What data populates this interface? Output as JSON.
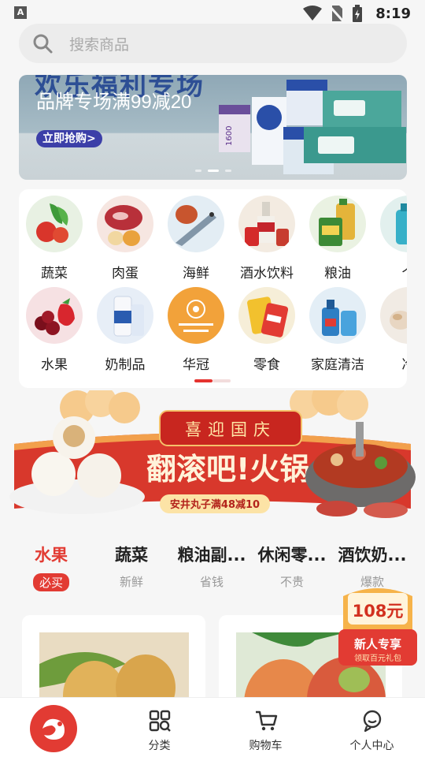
{
  "status_bar": {
    "app_badge": "A",
    "time": "8:19"
  },
  "search": {
    "placeholder": "搜索商品"
  },
  "banner": {
    "headline": "品牌专场满99减20",
    "cta": "立即抢购>",
    "faded_top": "欢乐福利专场",
    "product_badge": "1600"
  },
  "categories": [
    {
      "label": "蔬菜",
      "icon": "vegetables-icon",
      "color": "#e8f1e3"
    },
    {
      "label": "肉蛋",
      "icon": "meat-egg-icon",
      "color": "#f6e6e1"
    },
    {
      "label": "海鲜",
      "icon": "seafood-icon",
      "color": "#e3edf4"
    },
    {
      "label": "酒水饮料",
      "icon": "drinks-icon",
      "color": "#f3ebe1"
    },
    {
      "label": "粮油",
      "icon": "grain-oil-icon",
      "color": "#eaf2e2"
    },
    {
      "label": "个",
      "icon": "personal-care-icon",
      "color": "#e2f0ee"
    },
    {
      "label": "水果",
      "icon": "fruit-icon",
      "color": "#f6e1e3"
    },
    {
      "label": "奶制品",
      "icon": "dairy-icon",
      "color": "#e7eef7"
    },
    {
      "label": "华冠",
      "icon": "huaguan-logo-icon",
      "color": "#f2a23a"
    },
    {
      "label": "零食",
      "icon": "snacks-icon",
      "color": "#f6eed8"
    },
    {
      "label": "家庭清洁",
      "icon": "cleaning-icon",
      "color": "#e3eef6"
    },
    {
      "label": "冷",
      "icon": "frozen-icon",
      "color": "#f1ebe4"
    }
  ],
  "promo": {
    "header": "喜迎国庆",
    "title": "翻滚吧!火锅",
    "subtitle": "安井丸子满48减10"
  },
  "tabs": [
    {
      "title": "水果",
      "subtitle": "必买",
      "active": true
    },
    {
      "title": "蔬菜",
      "subtitle": "新鲜",
      "active": false
    },
    {
      "title": "粮油副...",
      "subtitle": "省钱",
      "active": false
    },
    {
      "title": "休闲零...",
      "subtitle": "不贵",
      "active": false
    },
    {
      "title": "酒饮奶...",
      "subtitle": "爆款",
      "active": false
    }
  ],
  "gift": {
    "amount": "108元",
    "title": "新人专享",
    "subtitle": "领取百元礼包"
  },
  "bottom_nav": [
    {
      "label": "",
      "icon": "home-logo-icon"
    },
    {
      "label": "分类",
      "icon": "category-grid-icon"
    },
    {
      "label": "购物车",
      "icon": "cart-icon"
    },
    {
      "label": "个人中心",
      "icon": "profile-icon"
    }
  ],
  "colors": {
    "accent": "#e23b33",
    "background": "#f6f6f6"
  }
}
